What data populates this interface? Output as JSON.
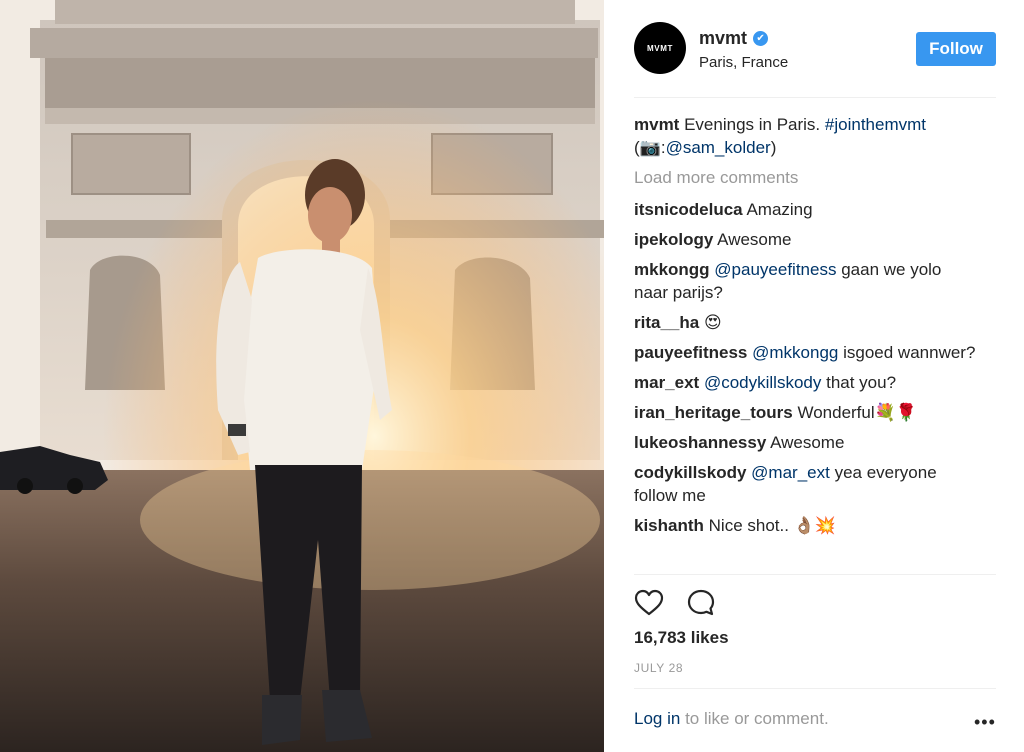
{
  "photo": {
    "description_icon": "photo-icon"
  },
  "header": {
    "avatar_text": "MVMT",
    "username": "mvmt",
    "verified_icon": "✔",
    "location": "Paris, France",
    "follow_label": "Follow"
  },
  "caption": {
    "user": "mvmt",
    "text": "Evenings in Paris.",
    "hashtag": "#jointhemvmt",
    "credit_prefix": "(📷:",
    "credit_user": "@sam_kolder",
    "credit_suffix": ")"
  },
  "load_more": "Load more comments",
  "comments": [
    {
      "user": "itsnicodeluca",
      "mention": "",
      "text": "Amazing"
    },
    {
      "user": "ipekology",
      "mention": "",
      "text": "Awesome"
    },
    {
      "user": "mkkongg",
      "mention": "@pauyeefitness",
      "text": "gaan we yolo naar parijs?"
    },
    {
      "user": "rita__ha",
      "mention": "",
      "text": "😍"
    },
    {
      "user": "pauyeefitness",
      "mention": "@mkkongg",
      "text": "isgoed wannwer?"
    },
    {
      "user": "mar_ext",
      "mention": "@codykillskody",
      "text": "that you?"
    },
    {
      "user": "iran_heritage_tours",
      "mention": "",
      "text": "Wonderful💐🌹"
    },
    {
      "user": "lukeoshannessy",
      "mention": "",
      "text": "Awesome"
    },
    {
      "user": "codykillskody",
      "mention": "@mar_ext",
      "text": "yea everyone follow me"
    },
    {
      "user": "kishanth",
      "mention": "",
      "text": "Nice shot.. 👌🏽💥"
    }
  ],
  "likes": "16,783 likes",
  "date": "JULY 28",
  "login": {
    "link": "Log in",
    "text": "to like or comment.",
    "more": "•••"
  },
  "icons": {
    "like": "heart-icon",
    "comment": "comment-bubble-icon",
    "more": "more-options-icon"
  }
}
